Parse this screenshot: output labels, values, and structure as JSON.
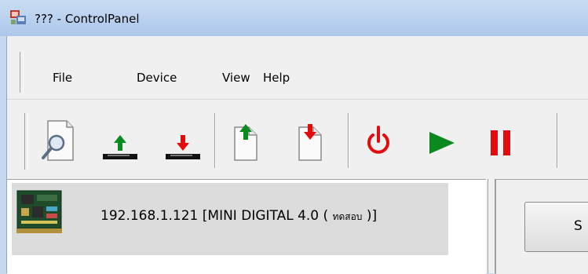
{
  "window": {
    "title": "??? - ControlPanel"
  },
  "menu": {
    "items": [
      "File",
      "Device",
      "View",
      "Help"
    ]
  },
  "toolbar": {
    "buttons": [
      {
        "name": "preview-icon"
      },
      {
        "name": "upload-icon"
      },
      {
        "name": "download-icon"
      },
      {
        "name": "file-upload-icon"
      },
      {
        "name": "file-download-icon"
      },
      {
        "name": "power-icon"
      },
      {
        "name": "play-icon"
      },
      {
        "name": "pause-icon"
      }
    ]
  },
  "device": {
    "label": "192.168.1.121 [MINI DIGITAL 4.0 ( ",
    "label_small": "ทดสอบ",
    "label_end": " )]"
  },
  "right_panel": {
    "button_label": "S"
  },
  "colors": {
    "green": "#0a8a1e",
    "red": "#e30c0c",
    "titlebar": "#b9d1ef"
  }
}
